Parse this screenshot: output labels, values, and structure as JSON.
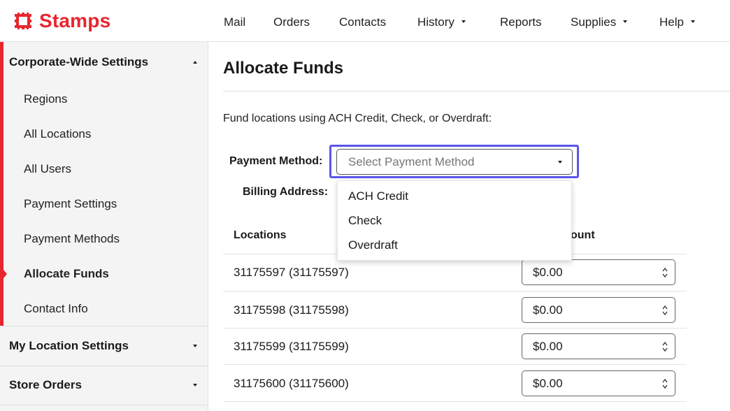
{
  "brand": {
    "name": "Stamps",
    "color": "#e8262d",
    "icon": "stamp-icon"
  },
  "nav": [
    {
      "label": "Mail",
      "dropdown": false
    },
    {
      "label": "Orders",
      "dropdown": false
    },
    {
      "label": "Contacts",
      "dropdown": false
    },
    {
      "label": "History",
      "dropdown": true
    },
    {
      "label": "Reports",
      "dropdown": false
    },
    {
      "label": "Supplies",
      "dropdown": true
    },
    {
      "label": "Help",
      "dropdown": true
    }
  ],
  "sidebar": {
    "sections": [
      {
        "label": "Corporate-Wide Settings",
        "expanded": true
      },
      {
        "label": "My Location Settings",
        "expanded": false
      },
      {
        "label": "Store Orders",
        "expanded": false
      }
    ],
    "items": [
      {
        "label": "Regions",
        "active": false
      },
      {
        "label": "All Locations",
        "active": false
      },
      {
        "label": "All Users",
        "active": false
      },
      {
        "label": "Payment Settings",
        "active": false
      },
      {
        "label": "Payment Methods",
        "active": false
      },
      {
        "label": "Allocate Funds",
        "active": true
      },
      {
        "label": "Contact Info",
        "active": false
      }
    ]
  },
  "main": {
    "title": "Allocate Funds",
    "intro": "Fund locations using ACH Credit, Check, or Overdraft:",
    "payment_method_label": "Payment Method:",
    "payment_method_placeholder": "Select Payment Method",
    "billing_address_label": "Billing Address:",
    "payment_options": [
      "ACH Credit",
      "Check",
      "Overdraft"
    ],
    "table": {
      "col_locations": "Locations",
      "col_amount_partial": "ount",
      "rows": [
        {
          "location": "31175597 (31175597)",
          "amount": "$0.00"
        },
        {
          "location": "31175598 (31175598)",
          "amount": "$0.00"
        },
        {
          "location": "31175599 (31175599)",
          "amount": "$0.00"
        },
        {
          "location": "31175600 (31175600)",
          "amount": "$0.00"
        }
      ]
    }
  },
  "colors": {
    "accent": "#e8262d",
    "focus": "#5b55e8"
  }
}
